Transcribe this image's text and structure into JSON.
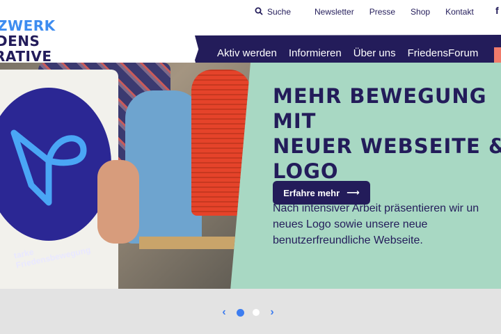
{
  "logo": {
    "line1": "ZWERK",
    "line2": "DENS",
    "line3": "RATIVE"
  },
  "topnav": {
    "search": "Suche",
    "links": [
      "Newsletter",
      "Presse",
      "Shop",
      "Kontakt"
    ],
    "facebook": "f"
  },
  "mainnav": {
    "items": [
      "Aktiv werden",
      "Informieren",
      "Über uns",
      "FriedensForum"
    ]
  },
  "hero": {
    "title_line1": "Mehr Bewegung mit",
    "title_line2": "neuer Webseite &",
    "title_line3": "Logo",
    "body": "Nach intensiver Arbeit präsentieren wir un neues Logo sowie unsere neue benutzerfreundliche Webseite.",
    "cta": "Erfahre mehr",
    "cta_icon": "⟶",
    "bag_text": "tarke Friedensbewegung"
  },
  "slider": {
    "prev": "‹",
    "next": "›",
    "dots": 2,
    "active": 0
  },
  "colors": {
    "navy": "#231c5a",
    "blue": "#3d8cf0",
    "mint": "#a8d8c3",
    "coral": "#f07b6b"
  }
}
